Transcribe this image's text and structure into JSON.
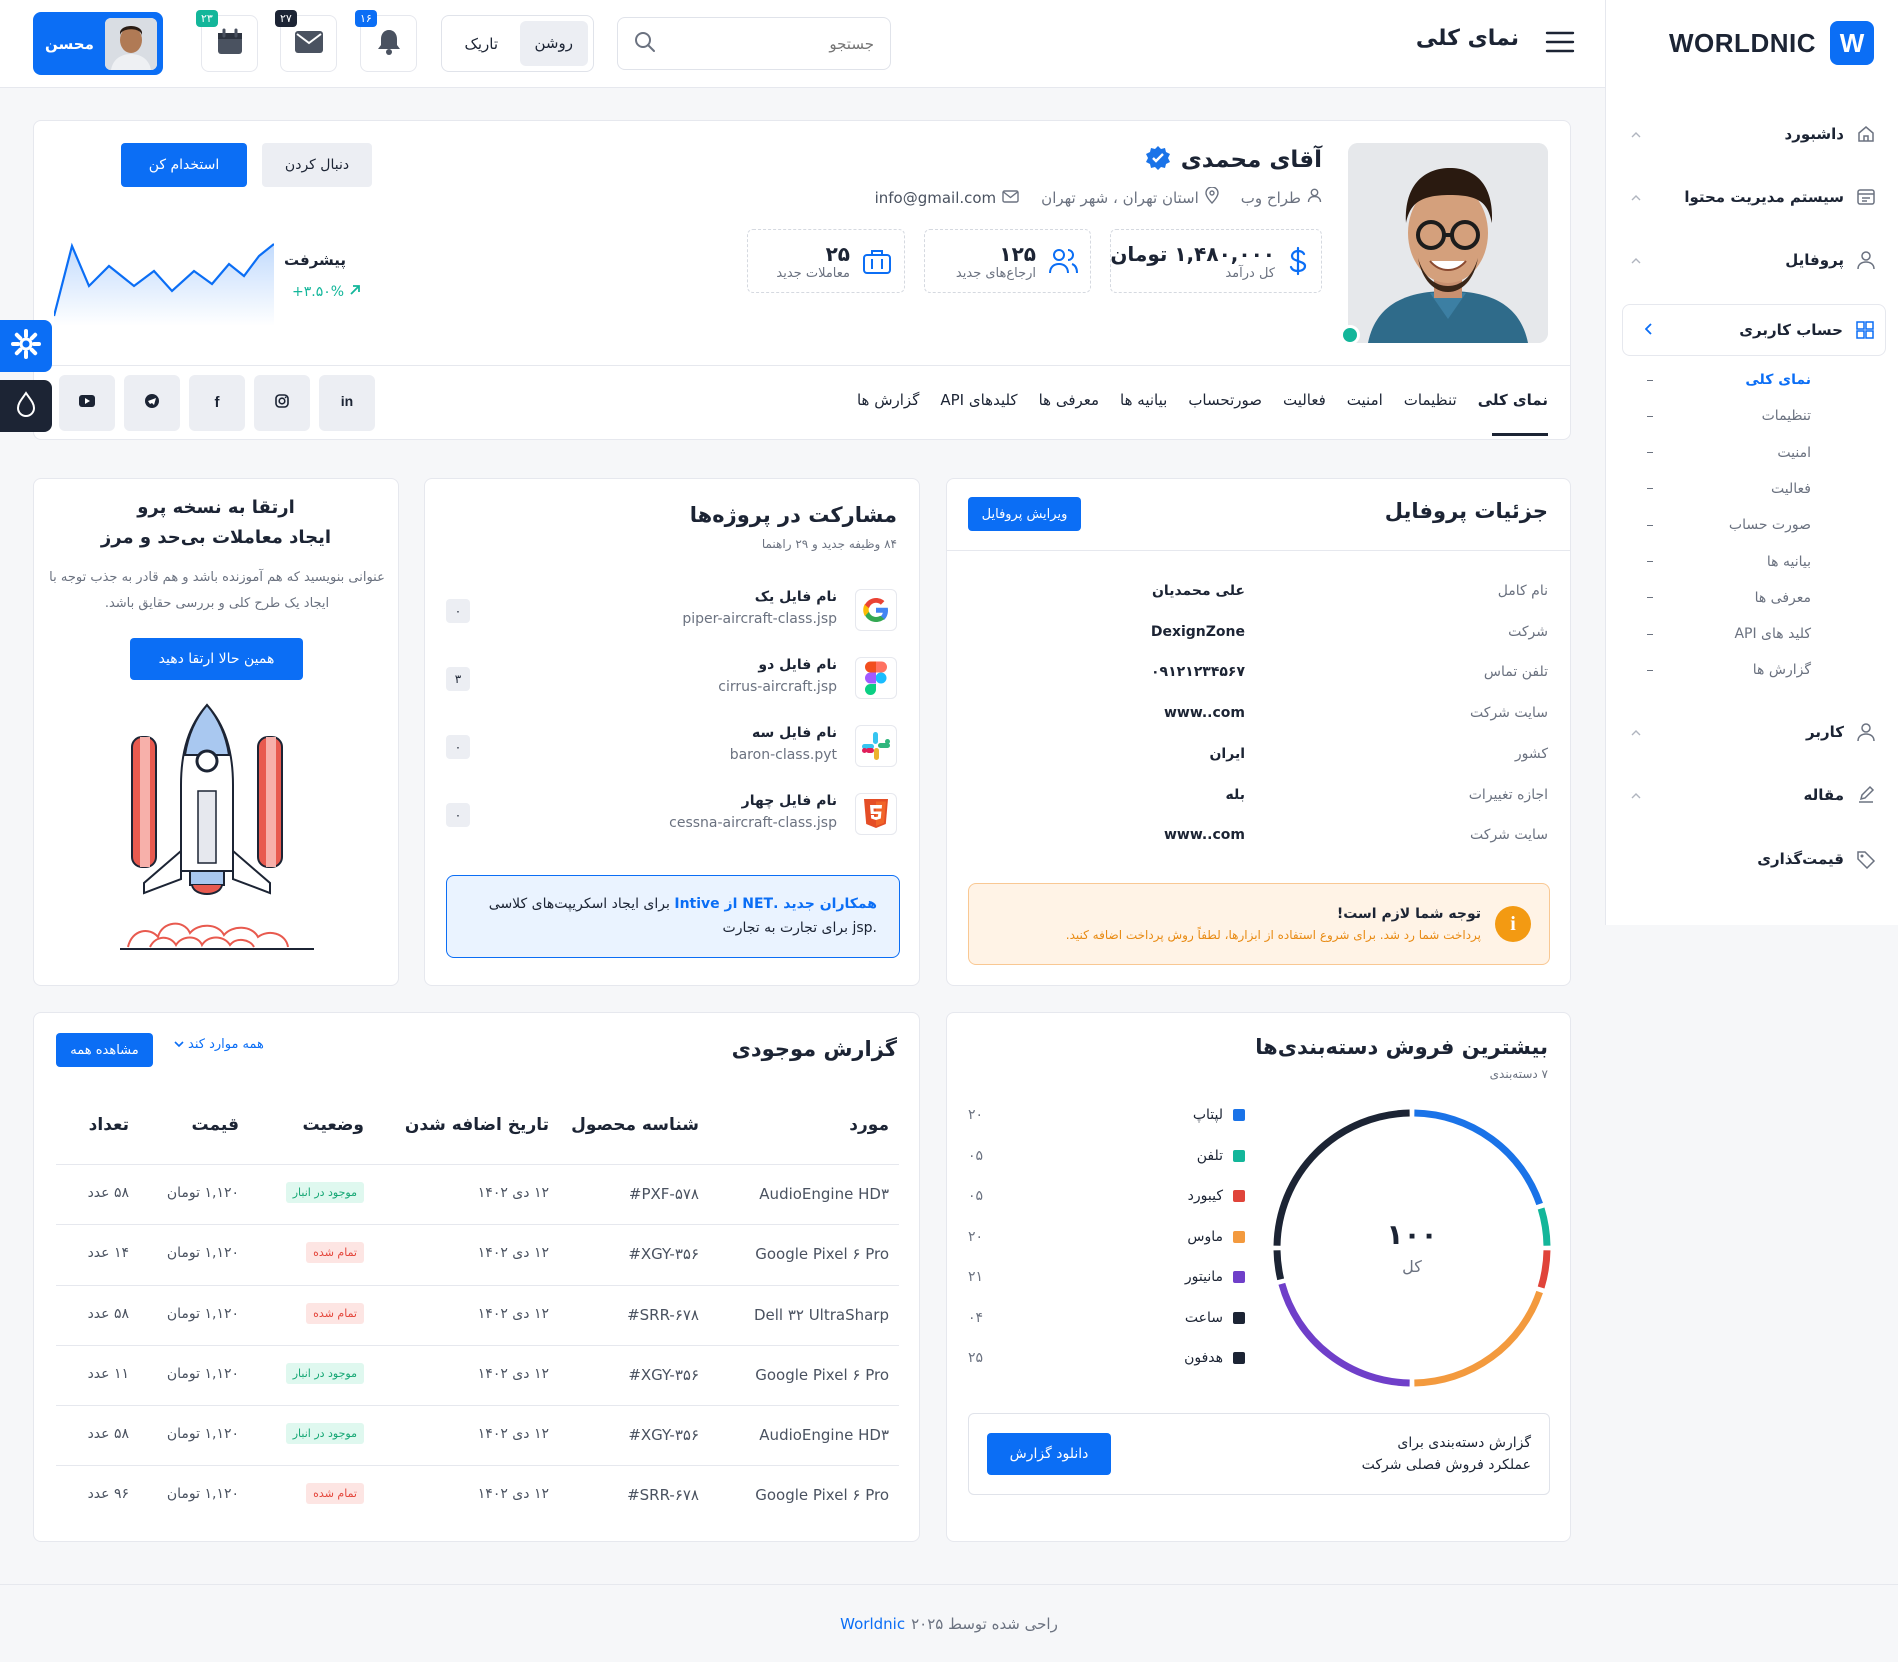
{
  "brand": {
    "name": "WORLDNIC",
    "logo_letter": "W"
  },
  "topbar": {
    "page_title": "نمای کلی",
    "search_placeholder": "جستجو",
    "theme_light": "روشن",
    "theme_dark": "تاریک",
    "notif_count": "۱۶",
    "mail_count": "۲۷",
    "calendar_count": "۲۳",
    "user_name": "محسن"
  },
  "sidebar": {
    "items": [
      {
        "label": "داشبورد",
        "icon": "home-icon"
      },
      {
        "label": "سیستم مدیریت محتوا",
        "icon": "cms-icon"
      },
      {
        "label": "پروفایل",
        "icon": "user-icon"
      },
      {
        "label": "حساب کاربری",
        "icon": "grid-icon"
      }
    ],
    "sub_items": [
      "نمای کلی",
      "تنظیمات",
      "امنیت",
      "فعالیت",
      "صورت حساب",
      "بیانیه ها",
      "معرفی ها",
      "کلید های API",
      "گزارش ها"
    ],
    "items2": [
      {
        "label": "کاربر",
        "icon": "user-icon"
      },
      {
        "label": "مقاله",
        "icon": "edit-icon"
      },
      {
        "label": "قیمت‌گذاری",
        "icon": "tag-icon"
      }
    ]
  },
  "profile": {
    "name": "آقای محمدی",
    "role": "طراح وب",
    "location": "استان تهران ، شهر تهران",
    "email": "info@gmail.com",
    "follow_label": "دنبال کردن",
    "hire_label": "استخدام کن",
    "progress_label": "پیشرفت",
    "progress_value": "۳.۵۰%+",
    "stats": [
      {
        "value": "۱,۴۸۰,۰۰۰ تومان",
        "label": "کل درآمد",
        "icon": "dollar-icon"
      },
      {
        "value": "۱۲۵",
        "label": "ارجاع‌های جدید",
        "icon": "users-icon"
      },
      {
        "value": "۲۵",
        "label": "معاملات جدید",
        "icon": "briefcase-icon"
      }
    ],
    "tabs": [
      "نمای کلی",
      "تنظیمات",
      "امنیت",
      "فعالیت",
      "صورتحساب",
      "بیانیه ها",
      "معرفی ها",
      "کلیدهای API",
      "گزارش ها"
    ],
    "social": [
      "in",
      "instagram",
      "f",
      "telegram",
      "youtube"
    ]
  },
  "details": {
    "title": "جزئیات پروفایل",
    "edit_label": "ویرایش پروفایل",
    "rows": [
      {
        "label": "نام کامل",
        "value": "علی محمدیان"
      },
      {
        "label": "شرکت",
        "value": "DexignZone"
      },
      {
        "label": "تلفن تماس",
        "value": "۰۹۱۲۱۲۳۴۵۶۷"
      },
      {
        "label": "سایت شرکت",
        "value": "www..com"
      },
      {
        "label": "کشور",
        "value": "ایران"
      },
      {
        "label": "اجازه تغییرات",
        "value": "بله"
      },
      {
        "label": "سایت شرکت",
        "value": "www..com"
      }
    ],
    "alert_title": "توجه شما لازم است!",
    "alert_text": "پرداخت شما رد شد. برای شروع استفاده از ابزارها، لطفاً روش پرداخت اضافه کنید."
  },
  "projects": {
    "title": "مشارکت در پروژه‌ها",
    "subtitle": "۸۴ وظیفه جدید و ۲۹ راهنما",
    "files": [
      {
        "name": "نام فایل یک",
        "file": "piper-aircraft-class.jsp",
        "count": "۰",
        "icon": "google-icon"
      },
      {
        "name": "نام فایل دو",
        "file": "cirrus-aircraft.jsp",
        "count": "۳",
        "icon": "figma-icon"
      },
      {
        "name": "نام فایل سه",
        "file": "baron-class.pyt",
        "count": "۰",
        "icon": "slack-icon"
      },
      {
        "name": "نام فایل چهار",
        "file": "cessna-aircraft-class.jsp",
        "count": "۰",
        "icon": "html5-icon"
      }
    ],
    "note_highlight": "همکاران جدید .NET از Intive",
    "note_rest": "برای ایجاد اسکریپت‌های کلاسی .jsp برای تجارت به تجارت"
  },
  "upgrade": {
    "title1": "ارتقا به نسخه پرو",
    "title2": "ایجاد معاملات بی‌حد و مرز",
    "text": "عنوانی بنویسید که هم آموزنده باشد و هم قادر به جذب توجه با ایجاد یک طرح کلی و بررسی حقایق باشد.",
    "cta": "همین حالا ارتقا دهید"
  },
  "sales": {
    "title": "بیشترین فروش دسته‌بندی‌ها",
    "subtitle": "۷ دسته‌بندی",
    "total": "۱۰۰",
    "total_label": "کل",
    "report_text": "گزارش دسته‌بندی برای عملکرد فروش فصلی شرکت",
    "download_label": "دانلود گزارش"
  },
  "chart_data": {
    "type": "pie",
    "donut": true,
    "categories": [
      "لپتاپ",
      "تلفن",
      "کیبورد",
      "ماوس",
      "مانیتور",
      "ساعت",
      "هدفون"
    ],
    "values": [
      20,
      5,
      5,
      20,
      21,
      4,
      25
    ],
    "value_labels": [
      "۲۰",
      "۰۵",
      "۰۵",
      "۲۰",
      "۲۱",
      "۰۴",
      "۲۵"
    ],
    "colors": [
      "#1a73e8",
      "#13b69a",
      "#e0443a",
      "#f39a3e",
      "#6f3fc9",
      "#1c2434",
      "#1c2434"
    ]
  },
  "inventory": {
    "title": "گزارش موجودی",
    "filter_label": "همه موارد کند",
    "view_all": "مشاهده همه",
    "headers": [
      "مورد",
      "شناسه محصول",
      "تاریخ اضافه شدن",
      "وضعیت",
      "قیمت",
      "تعداد"
    ],
    "rows": [
      {
        "item": "AudioEngine HD۳",
        "id": "#PXF-۵۷۸",
        "date": "۱۲ دی ۱۴۰۲",
        "status": "موجود در انبار",
        "status_type": "in",
        "price": "۱,۱۲۰ تومان",
        "qty": "۵۸ عدد"
      },
      {
        "item": "Google Pixel ۶ Pro",
        "id": "#XGY-۳۵۶",
        "date": "۱۲ دی ۱۴۰۲",
        "status": "تمام شده",
        "status_type": "out",
        "price": "۱,۱۲۰ تومان",
        "qty": "۱۴ عدد"
      },
      {
        "item": "Dell ۳۲ UltraSharp",
        "id": "#SRR-۶۷۸",
        "date": "۱۲ دی ۱۴۰۲",
        "status": "تمام شده",
        "status_type": "out",
        "price": "۱,۱۲۰ تومان",
        "qty": "۵۸ عدد"
      },
      {
        "item": "Google Pixel ۶ Pro",
        "id": "#XGY-۳۵۶",
        "date": "۱۲ دی ۱۴۰۲",
        "status": "موجود در انبار",
        "status_type": "in",
        "price": "۱,۱۲۰ تومان",
        "qty": "۱۱ عدد"
      },
      {
        "item": "AudioEngine HD۳",
        "id": "#XGY-۳۵۶",
        "date": "۱۲ دی ۱۴۰۲",
        "status": "موجود در انبار",
        "status_type": "in",
        "price": "۱,۱۲۰ تومان",
        "qty": "۵۸ عدد"
      },
      {
        "item": "Google Pixel ۶ Pro",
        "id": "#SRR-۶۷۸",
        "date": "۱۲ دی ۱۴۰۲",
        "status": "تمام شده",
        "status_type": "out",
        "price": "۱,۱۲۰ تومان",
        "qty": "۹۶ عدد"
      }
    ]
  },
  "footer": {
    "text": "راحی شده توسط ۲۰۲۵",
    "brand": "Worldnic"
  }
}
